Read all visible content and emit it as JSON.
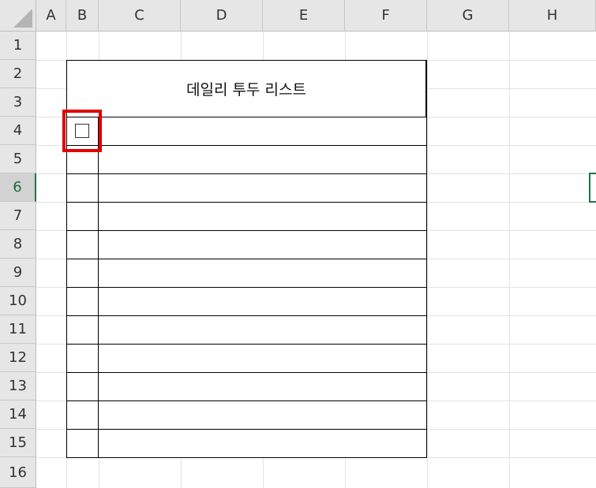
{
  "columns": [
    "A",
    "B",
    "C",
    "D",
    "E",
    "F",
    "G",
    "H"
  ],
  "rows": [
    "1",
    "2",
    "3",
    "4",
    "5",
    "6",
    "7",
    "8",
    "9",
    "10",
    "11",
    "12",
    "13",
    "14",
    "15",
    "16"
  ],
  "selected_row": "6",
  "table": {
    "title": "데일리 투두 리스트",
    "checkbox_glyph": "",
    "item_count": 11
  },
  "colors": {
    "highlight": "#e00000",
    "selection": "#217346"
  }
}
